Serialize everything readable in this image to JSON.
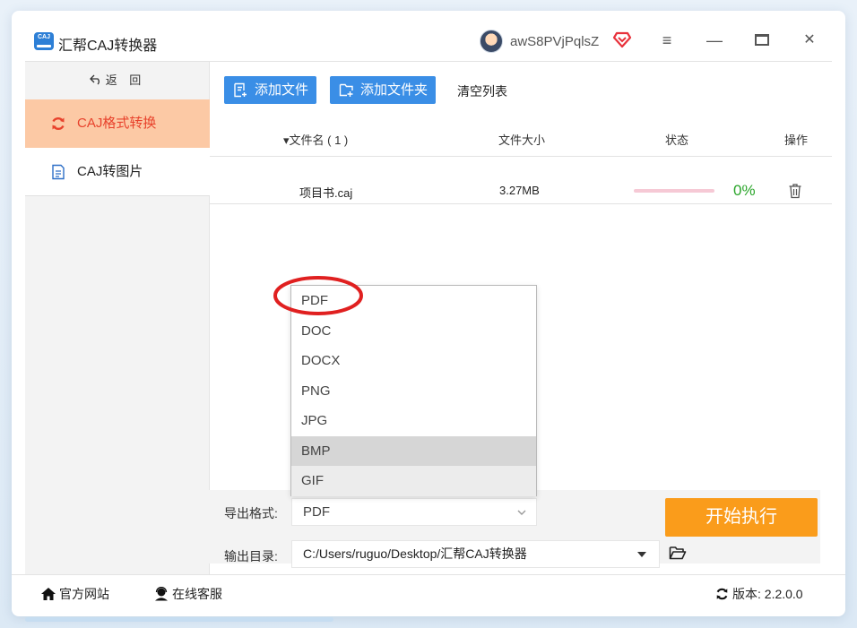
{
  "app": {
    "title": "汇帮CAJ转换器",
    "logo_text": "CAJ",
    "username": "awS8PVjPqlsZ"
  },
  "window_controls": {
    "menu": "≡",
    "minimize": "—",
    "close": "✕"
  },
  "sidebar": {
    "back_label": "返 回",
    "items": [
      {
        "label": "CAJ格式转换",
        "active": true,
        "icon": "refresh-icon"
      },
      {
        "label": "CAJ转图片",
        "active": false,
        "icon": "document-icon"
      }
    ]
  },
  "toolbar": {
    "add_file": "添加文件",
    "add_folder": "添加文件夹",
    "clear_list": "清空列表"
  },
  "table": {
    "headers": {
      "name": "▾文件名 ( 1 )",
      "size": "文件大小",
      "status": "状态",
      "op": "操作"
    },
    "rows": [
      {
        "name": "项目书.caj",
        "size": "3.27MB",
        "progress": 0,
        "progress_text": "0%"
      }
    ]
  },
  "format_dropdown": {
    "options": [
      "PDF",
      "DOC",
      "DOCX",
      "PNG",
      "JPG",
      "BMP",
      "GIF"
    ],
    "highlighted": "BMP",
    "hovered": "GIF"
  },
  "settings": {
    "format_label": "导出格式:",
    "format_value": "PDF",
    "output_label": "输出目录:",
    "output_value": "C:/Users/ruguo/Desktop/汇帮CAJ转换器",
    "start_button": "开始执行"
  },
  "footer": {
    "site": "官方网站",
    "service": "在线客服",
    "version_label": "版本: 2.2.0.0"
  },
  "colors": {
    "accent_blue": "#3a8ee6",
    "active_bg": "#fcc9a5",
    "active_text": "#e8422c",
    "start_orange": "#fa9c1b",
    "progress_green": "#2aa52a",
    "annotation_red": "#e02020"
  }
}
